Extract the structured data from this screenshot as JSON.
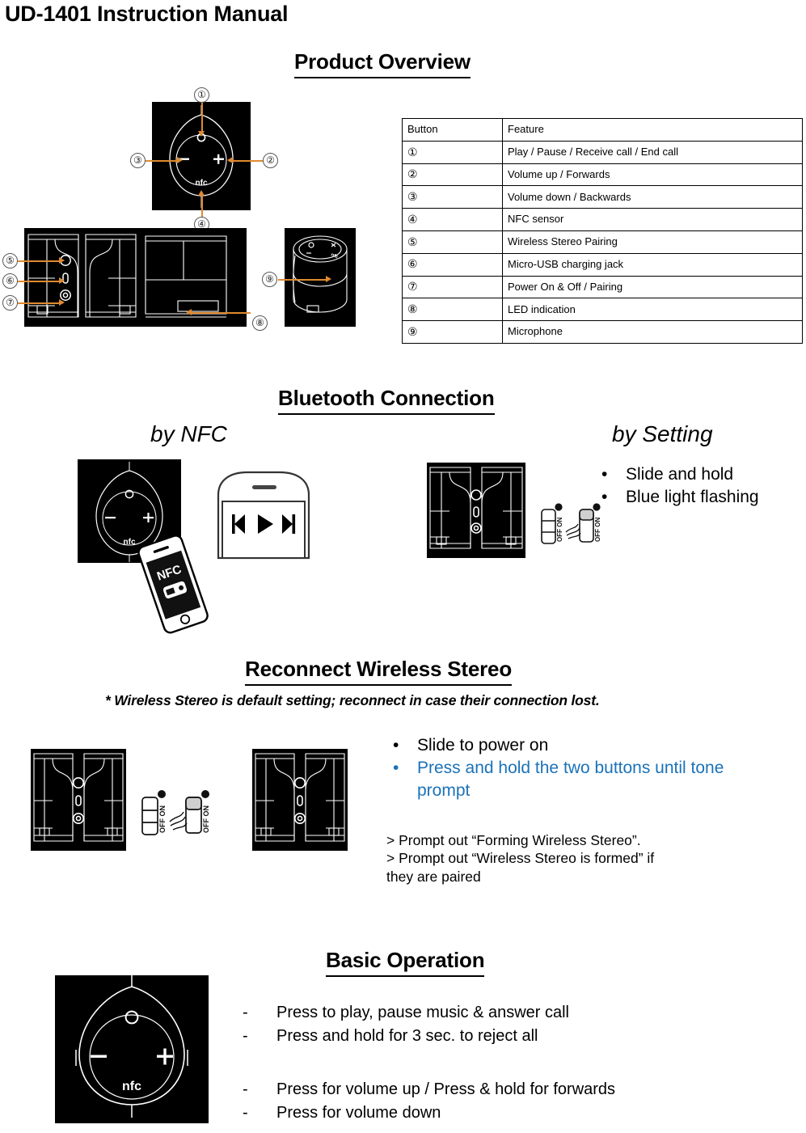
{
  "document": {
    "title": "UD-1401 Instruction Manual"
  },
  "sections": {
    "product_overview": {
      "heading": "Product Overview",
      "table": {
        "headers": [
          "Button",
          "Feature"
        ],
        "rows": [
          {
            "button": "①",
            "feature": "Play / Pause / Receive call / End call"
          },
          {
            "button": "②",
            "feature": "Volume up / Forwards"
          },
          {
            "button": "③",
            "feature": "Volume down / Backwards"
          },
          {
            "button": "④",
            "feature": "NFC sensor"
          },
          {
            "button": "⑤",
            "feature": "Wireless Stereo Pairing"
          },
          {
            "button": "⑥",
            "feature": "Micro-USB charging jack"
          },
          {
            "button": "⑦",
            "feature": "Power On & Off / Pairing"
          },
          {
            "button": "⑧",
            "feature": "LED indication"
          },
          {
            "button": "⑨",
            "feature": "Microphone"
          }
        ]
      },
      "diagram": {
        "top_view_label": "nfc",
        "minus_label": "–",
        "plus_label": "+",
        "callouts": [
          "①",
          "②",
          "③",
          "④",
          "⑤",
          "⑥",
          "⑦",
          "⑧",
          "⑨"
        ]
      }
    },
    "bluetooth_connection": {
      "heading": "Bluetooth Connection",
      "by_nfc": {
        "subheading": "by NFC",
        "device_label": "nfc",
        "phone_label": "NFC"
      },
      "by_setting": {
        "subheading": "by Setting",
        "bullets": [
          "Slide and hold",
          "Blue light flashing"
        ],
        "switch_labels": {
          "off": "OFF",
          "on": "ON"
        }
      }
    },
    "reconnect_wireless_stereo": {
      "heading": "Reconnect Wireless Stereo",
      "note": "* Wireless Stereo is default setting; reconnect in case their connection lost.",
      "bullets": [
        {
          "text": "Slide to power on",
          "color": "#000000"
        },
        {
          "text": "Press and hold the two buttons until tone prompt",
          "color": "#1B72B8"
        }
      ],
      "prompts": [
        "> Prompt out “Forming Wireless Stereo”.",
        "> Prompt out “Wireless Stereo is formed” if",
        "they are paired"
      ],
      "switch_labels": {
        "off": "OFF",
        "on": "ON"
      }
    },
    "basic_operation": {
      "heading": "Basic Operation",
      "device_label": "nfc",
      "minus_label": "–",
      "plus_label": "+",
      "items_group_1": [
        "Press to play, pause music & answer call",
        "Press and hold for 3 sec. to reject all"
      ],
      "items_group_2": [
        "Press for volume up / Press & hold for forwards",
        "Press for volume down"
      ],
      "dash": "-"
    }
  },
  "colors": {
    "accent_blue": "#1B72B8",
    "callout_orange": "#E08A30",
    "panel_black": "#000000",
    "text_black": "#000000"
  }
}
